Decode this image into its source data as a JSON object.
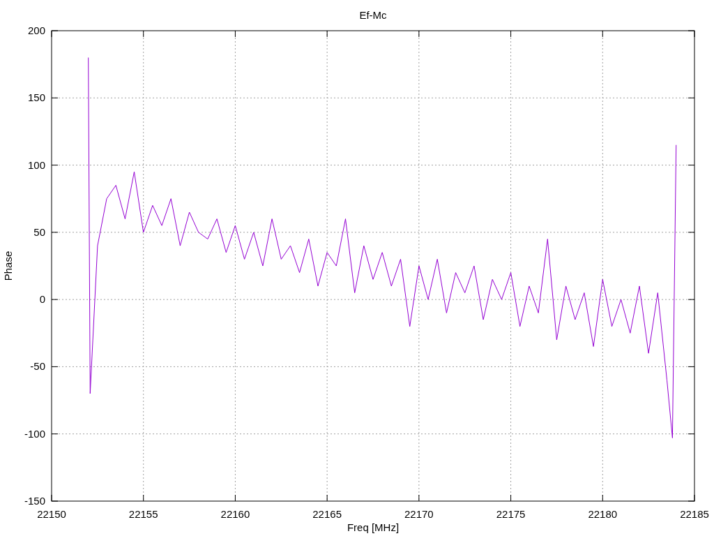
{
  "chart_data": {
    "type": "line",
    "title": "Ef-Mc",
    "xlabel": "Freq [MHz]",
    "ylabel": "Phase",
    "grid": true,
    "xlim": [
      22150,
      22185
    ],
    "ylim": [
      -150,
      200
    ],
    "xticks": [
      22150,
      22155,
      22160,
      22165,
      22170,
      22175,
      22180,
      22185
    ],
    "yticks": [
      -150,
      -100,
      -50,
      0,
      50,
      100,
      150,
      200
    ],
    "x": [
      22152,
      22152.1,
      22152.5,
      22153,
      22153.5,
      22154,
      22154.5,
      22155,
      22155.5,
      22156,
      22156.5,
      22157,
      22157.5,
      22158,
      22158.5,
      22159,
      22159.5,
      22160,
      22160.5,
      22161,
      22161.5,
      22162,
      22162.5,
      22163,
      22163.5,
      22164,
      22164.5,
      22165,
      22165.5,
      22166,
      22166.5,
      22167,
      22167.5,
      22168,
      22168.5,
      22169,
      22169.5,
      22170,
      22170.5,
      22171,
      22171.5,
      22172,
      22172.5,
      22173,
      22173.5,
      22174,
      22174.5,
      22175,
      22175.5,
      22176,
      22176.5,
      22177,
      22177.5,
      22178,
      22178.5,
      22179,
      22179.5,
      22180,
      22180.5,
      22181,
      22181.5,
      22182,
      22182.5,
      22183,
      22183.5,
      22183.8,
      22184
    ],
    "series": [
      {
        "color": "#9400d3",
        "values": [
          180,
          -70,
          40,
          75,
          85,
          60,
          95,
          50,
          70,
          55,
          75,
          40,
          65,
          50,
          45,
          60,
          35,
          55,
          30,
          50,
          25,
          60,
          30,
          40,
          20,
          45,
          10,
          35,
          25,
          60,
          5,
          40,
          15,
          35,
          10,
          30,
          -20,
          25,
          0,
          30,
          -10,
          20,
          5,
          25,
          -15,
          15,
          0,
          20,
          -20,
          10,
          -10,
          45,
          -30,
          10,
          -15,
          5,
          -35,
          15,
          -20,
          0,
          -25,
          10,
          -40,
          5,
          -60,
          -103,
          115
        ]
      }
    ]
  }
}
